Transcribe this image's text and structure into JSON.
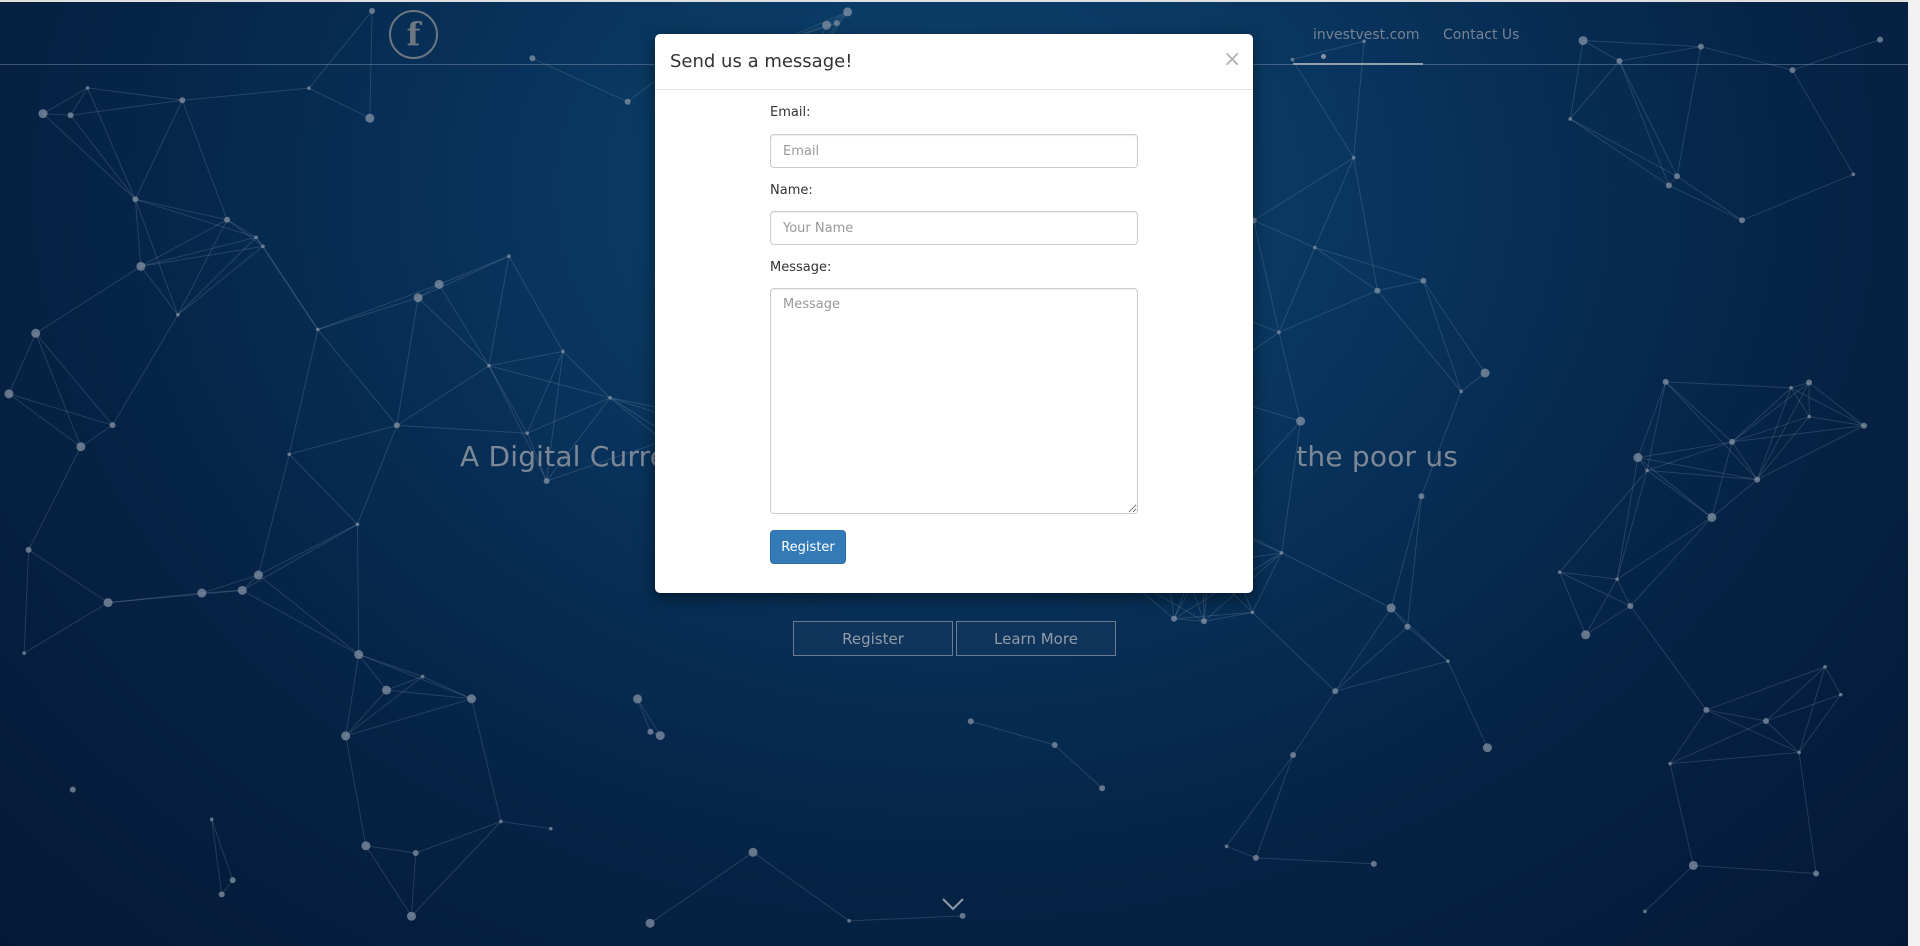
{
  "nav": {
    "logo_glyph": "f",
    "logo_icon": "facebook-icon",
    "links": [
      {
        "label": "investvest.com",
        "active": true
      },
      {
        "label": "Contact Us",
        "active": false
      }
    ]
  },
  "hero": {
    "tagline_left": "A Digital Curren",
    "tagline_right": " the poor using",
    "buttons": {
      "register_label": "Register",
      "learn_more_label": "Learn More"
    },
    "scroll_icon": "chevron-down-icon"
  },
  "modal": {
    "title": "Send us a message!",
    "close_glyph": "×",
    "fields": {
      "email": {
        "label": "Email:",
        "placeholder": "Email",
        "value": ""
      },
      "name": {
        "label": "Name:",
        "placeholder": "Your Name",
        "value": ""
      },
      "message": {
        "label": "Message:",
        "placeholder": "Message",
        "value": ""
      }
    },
    "submit_label": "Register"
  },
  "colors": {
    "hero_background": "#0a3a68",
    "primary_button": "#337ab7",
    "nav_text": "#8796a8"
  }
}
